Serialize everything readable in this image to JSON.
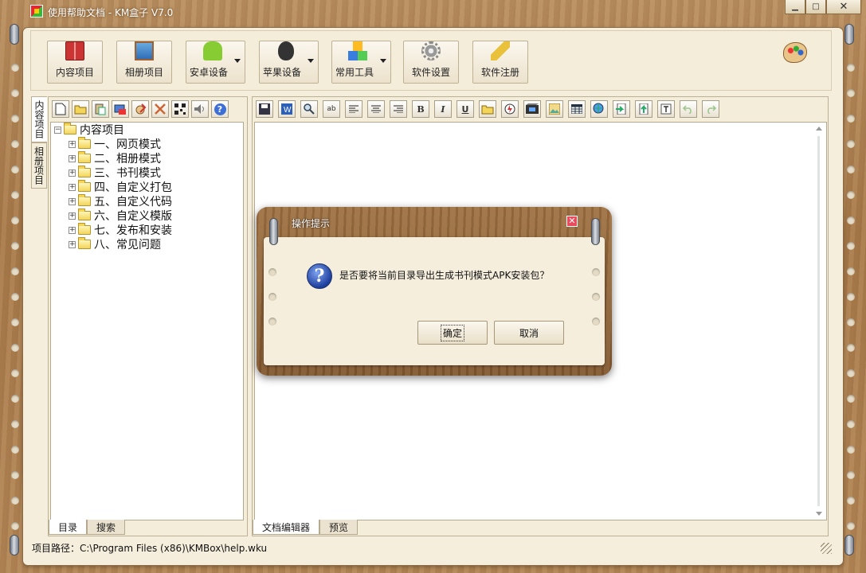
{
  "window": {
    "title": "使用帮助文档 - KM盒子 V7.0",
    "min_glyph": "▁",
    "max_glyph": "□",
    "close_glyph": "✕"
  },
  "toolbar": {
    "buttons": [
      {
        "label": "内容项目",
        "icon": "book-icon"
      },
      {
        "label": "相册项目",
        "icon": "album-icon"
      },
      {
        "label": "安卓设备",
        "icon": "android-icon"
      },
      {
        "label": "苹果设备",
        "icon": "apple-icon"
      },
      {
        "label": "常用工具",
        "icon": "tools-icon"
      },
      {
        "label": "软件设置",
        "icon": "gear-icon"
      },
      {
        "label": "软件注册",
        "icon": "key-icon"
      }
    ]
  },
  "side_tabs": [
    "内容项目",
    "相册项目"
  ],
  "left_panel": {
    "tree_root": "内容项目",
    "tree_items": [
      "一、网页模式",
      "二、相册模式",
      "三、书刊模式",
      "四、自定义打包",
      "五、自定义代码",
      "六、自定义模版",
      "七、发布和安装",
      "八、常见问题"
    ],
    "tabs": [
      "目录",
      "搜索"
    ]
  },
  "right_panel": {
    "tabs": [
      "文档编辑器",
      "预览"
    ]
  },
  "status": {
    "path": "项目路径：C:\\Program Files (x86)\\KMBox\\help.wku"
  },
  "dialog": {
    "title": "操作提示",
    "message": "是否要将当前目录导出生成书刊模式APK安装包？",
    "ok_label": "确定",
    "cancel_label": "取消",
    "close_glyph": "✕",
    "icon_glyph": "?"
  },
  "mini_toolbar_left": {
    "glyph_about": "?"
  },
  "editor_toolbar": {
    "bold": "B",
    "italic": "I",
    "underline": "U",
    "spell": "ab"
  }
}
